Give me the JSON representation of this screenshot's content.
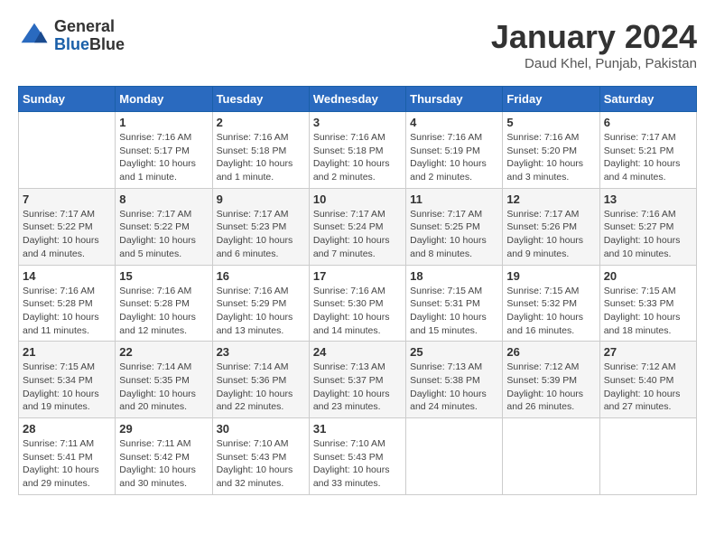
{
  "header": {
    "logo_general": "General",
    "logo_blue": "Blue",
    "month": "January 2024",
    "location": "Daud Khel, Punjab, Pakistan"
  },
  "days_of_week": [
    "Sunday",
    "Monday",
    "Tuesday",
    "Wednesday",
    "Thursday",
    "Friday",
    "Saturday"
  ],
  "weeks": [
    [
      {
        "day": "",
        "info": ""
      },
      {
        "day": "1",
        "info": "Sunrise: 7:16 AM\nSunset: 5:17 PM\nDaylight: 10 hours\nand 1 minute."
      },
      {
        "day": "2",
        "info": "Sunrise: 7:16 AM\nSunset: 5:18 PM\nDaylight: 10 hours\nand 1 minute."
      },
      {
        "day": "3",
        "info": "Sunrise: 7:16 AM\nSunset: 5:18 PM\nDaylight: 10 hours\nand 2 minutes."
      },
      {
        "day": "4",
        "info": "Sunrise: 7:16 AM\nSunset: 5:19 PM\nDaylight: 10 hours\nand 2 minutes."
      },
      {
        "day": "5",
        "info": "Sunrise: 7:16 AM\nSunset: 5:20 PM\nDaylight: 10 hours\nand 3 minutes."
      },
      {
        "day": "6",
        "info": "Sunrise: 7:17 AM\nSunset: 5:21 PM\nDaylight: 10 hours\nand 4 minutes."
      }
    ],
    [
      {
        "day": "7",
        "info": "Sunrise: 7:17 AM\nSunset: 5:22 PM\nDaylight: 10 hours\nand 4 minutes."
      },
      {
        "day": "8",
        "info": "Sunrise: 7:17 AM\nSunset: 5:22 PM\nDaylight: 10 hours\nand 5 minutes."
      },
      {
        "day": "9",
        "info": "Sunrise: 7:17 AM\nSunset: 5:23 PM\nDaylight: 10 hours\nand 6 minutes."
      },
      {
        "day": "10",
        "info": "Sunrise: 7:17 AM\nSunset: 5:24 PM\nDaylight: 10 hours\nand 7 minutes."
      },
      {
        "day": "11",
        "info": "Sunrise: 7:17 AM\nSunset: 5:25 PM\nDaylight: 10 hours\nand 8 minutes."
      },
      {
        "day": "12",
        "info": "Sunrise: 7:17 AM\nSunset: 5:26 PM\nDaylight: 10 hours\nand 9 minutes."
      },
      {
        "day": "13",
        "info": "Sunrise: 7:16 AM\nSunset: 5:27 PM\nDaylight: 10 hours\nand 10 minutes."
      }
    ],
    [
      {
        "day": "14",
        "info": "Sunrise: 7:16 AM\nSunset: 5:28 PM\nDaylight: 10 hours\nand 11 minutes."
      },
      {
        "day": "15",
        "info": "Sunrise: 7:16 AM\nSunset: 5:28 PM\nDaylight: 10 hours\nand 12 minutes."
      },
      {
        "day": "16",
        "info": "Sunrise: 7:16 AM\nSunset: 5:29 PM\nDaylight: 10 hours\nand 13 minutes."
      },
      {
        "day": "17",
        "info": "Sunrise: 7:16 AM\nSunset: 5:30 PM\nDaylight: 10 hours\nand 14 minutes."
      },
      {
        "day": "18",
        "info": "Sunrise: 7:15 AM\nSunset: 5:31 PM\nDaylight: 10 hours\nand 15 minutes."
      },
      {
        "day": "19",
        "info": "Sunrise: 7:15 AM\nSunset: 5:32 PM\nDaylight: 10 hours\nand 16 minutes."
      },
      {
        "day": "20",
        "info": "Sunrise: 7:15 AM\nSunset: 5:33 PM\nDaylight: 10 hours\nand 18 minutes."
      }
    ],
    [
      {
        "day": "21",
        "info": "Sunrise: 7:15 AM\nSunset: 5:34 PM\nDaylight: 10 hours\nand 19 minutes."
      },
      {
        "day": "22",
        "info": "Sunrise: 7:14 AM\nSunset: 5:35 PM\nDaylight: 10 hours\nand 20 minutes."
      },
      {
        "day": "23",
        "info": "Sunrise: 7:14 AM\nSunset: 5:36 PM\nDaylight: 10 hours\nand 22 minutes."
      },
      {
        "day": "24",
        "info": "Sunrise: 7:13 AM\nSunset: 5:37 PM\nDaylight: 10 hours\nand 23 minutes."
      },
      {
        "day": "25",
        "info": "Sunrise: 7:13 AM\nSunset: 5:38 PM\nDaylight: 10 hours\nand 24 minutes."
      },
      {
        "day": "26",
        "info": "Sunrise: 7:12 AM\nSunset: 5:39 PM\nDaylight: 10 hours\nand 26 minutes."
      },
      {
        "day": "27",
        "info": "Sunrise: 7:12 AM\nSunset: 5:40 PM\nDaylight: 10 hours\nand 27 minutes."
      }
    ],
    [
      {
        "day": "28",
        "info": "Sunrise: 7:11 AM\nSunset: 5:41 PM\nDaylight: 10 hours\nand 29 minutes."
      },
      {
        "day": "29",
        "info": "Sunrise: 7:11 AM\nSunset: 5:42 PM\nDaylight: 10 hours\nand 30 minutes."
      },
      {
        "day": "30",
        "info": "Sunrise: 7:10 AM\nSunset: 5:43 PM\nDaylight: 10 hours\nand 32 minutes."
      },
      {
        "day": "31",
        "info": "Sunrise: 7:10 AM\nSunset: 5:43 PM\nDaylight: 10 hours\nand 33 minutes."
      },
      {
        "day": "",
        "info": ""
      },
      {
        "day": "",
        "info": ""
      },
      {
        "day": "",
        "info": ""
      }
    ]
  ]
}
